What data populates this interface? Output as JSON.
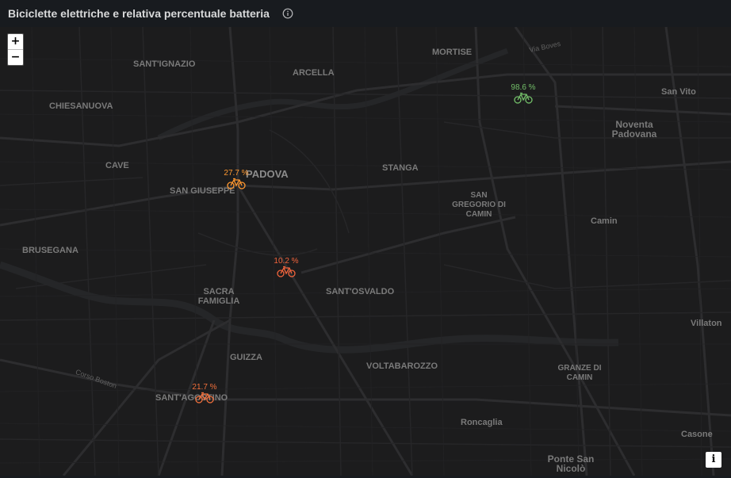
{
  "panel": {
    "title": "Biciclette elettriche e relativa percentuale batteria",
    "info_icon": "info-circle-icon"
  },
  "map": {
    "zoom_in_label": "+",
    "zoom_out_label": "−",
    "attribution_label": "i",
    "places": {
      "mortise": "MORTISE",
      "santignazio": "SANT'IGNAZIO",
      "arcella": "ARCELLA",
      "chiesanuova": "CHIESANUOVA",
      "cave": "CAVE",
      "sangiuseppe": "SAN GIUSEPPE",
      "padova": "PADOVA",
      "stanga": "STANGA",
      "sangregorio": "SAN GREGORIO DI CAMIN",
      "brusegana": "BRUSEGANA",
      "sacrafamiglia": "SACRA FAMIGLIA",
      "santosvaldo": "SANT'OSVALDO",
      "guizza": "GUIZZA",
      "voltabarozzo": "VOLTABAROZZO",
      "santagostino": "SANT'AGOSTINO",
      "roncaglia": "Roncaglia",
      "pontesannicolo": "Ponte San Nicolò",
      "sanvito": "San Vito",
      "noventa": "Noventa Padovana",
      "camin": "Camin",
      "granzedicamin": "GRANZE DI CAMIN",
      "villaton": "Villaton",
      "casone": "Casone",
      "viaboves": "Via Boves",
      "corsoboston": "Corso Boston"
    },
    "markers": [
      {
        "battery": "98.6 %",
        "icon": "bicycle-icon",
        "color": "#73bf69"
      },
      {
        "battery": "27.7 %",
        "icon": "bicycle-icon",
        "color": "#ff9830"
      },
      {
        "battery": "10.2 %",
        "icon": "bicycle-icon",
        "color": "#f2643c"
      },
      {
        "battery": "21.7 %",
        "icon": "bicycle-icon",
        "color": "#f2703c"
      }
    ]
  }
}
